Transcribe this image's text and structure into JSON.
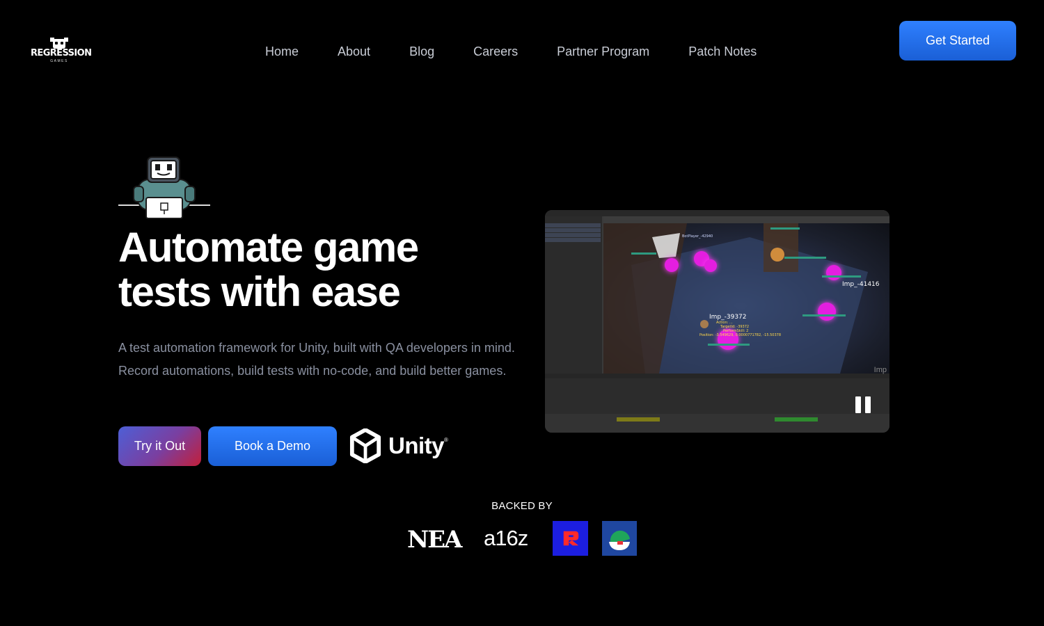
{
  "brand": {
    "name": "REGRESSION",
    "sub": "GAMES"
  },
  "nav": {
    "items": [
      "Home",
      "About",
      "Blog",
      "Careers",
      "Partner Program",
      "Patch Notes"
    ],
    "cta": "Get Started"
  },
  "hero": {
    "title": "Automate game tests with ease",
    "description": "A test automation framework for Unity, built with QA developers in mind. Record automations, build tests with no-code, and build better games.",
    "primary_button": "Try it Out",
    "secondary_button": "Book a Demo",
    "partner_logo": "Unity",
    "partner_logo_mark": "®"
  },
  "video": {
    "labels": {
      "imp_center": "Imp_-39372",
      "imp_right": "Imp_-41416",
      "bot_player": "BotPlayer_-42940",
      "action_line": "Action: ...",
      "target_line": "TargetId: -39372",
      "skill_line": "PerformSkill: 2",
      "position_line": "Position: -3.549629, 0.0000771782, -15.50378",
      "corner": "Imp"
    },
    "state": "playing"
  },
  "backers": {
    "heading": "BACKED BY",
    "logos": [
      "NEA",
      "a16z"
    ]
  },
  "colors": {
    "accent_blue": "#2f80ff",
    "gradient_red": "#c21f3a",
    "text_muted": "#8a90a0"
  }
}
